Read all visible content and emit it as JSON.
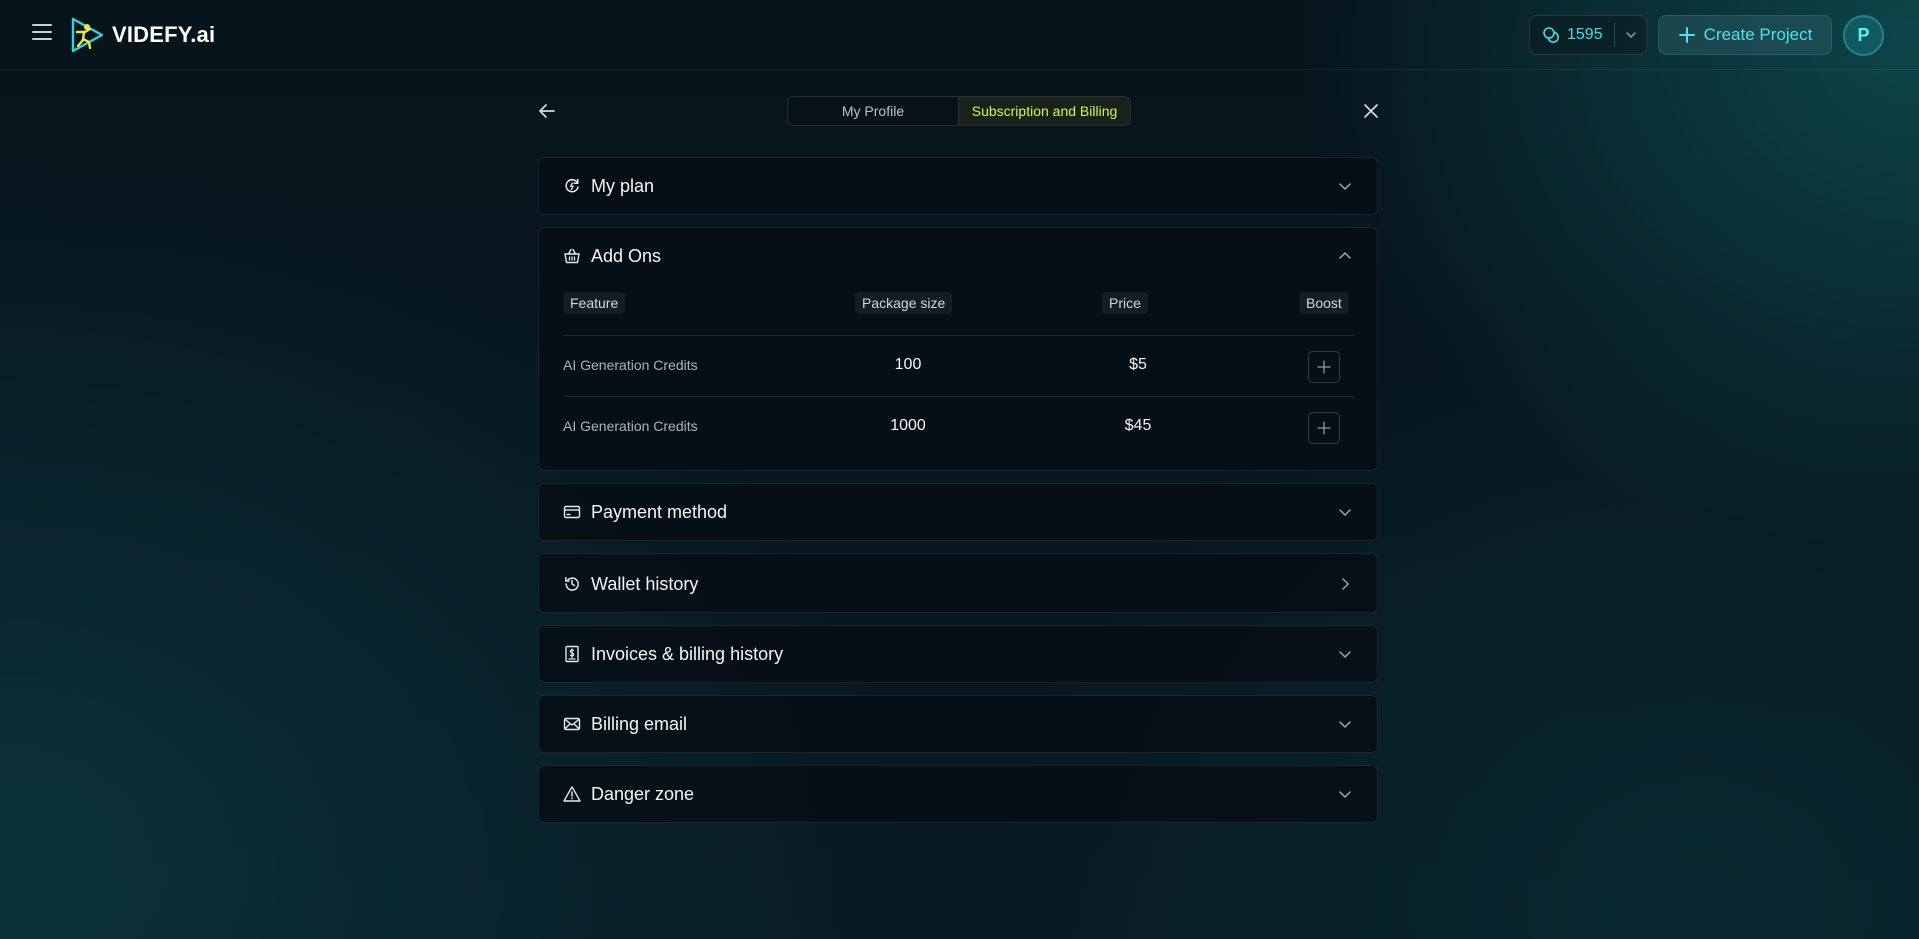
{
  "app": {
    "brand": "VIDEFY.ai",
    "credits": "1595",
    "create_label": "Create Project",
    "avatar_initial": "P",
    "accent": "#3fe0e4"
  },
  "tabs": [
    {
      "label": "My Profile",
      "active": false
    },
    {
      "label": "Subscription and Billing",
      "active": true
    }
  ],
  "sections": {
    "my_plan": "My plan",
    "add_ons": "Add Ons",
    "payment_method": "Payment method",
    "wallet_history": "Wallet history",
    "invoices": "Invoices & billing history",
    "billing_email": "Billing email",
    "danger_zone": "Danger zone"
  },
  "addons": {
    "columns": [
      "Feature",
      "Package size",
      "Price",
      "Boost"
    ],
    "rows": [
      {
        "feature": "AI Generation Credits",
        "size": "100",
        "price": "$5"
      },
      {
        "feature": "AI Generation Credits",
        "size": "1000",
        "price": "$45"
      }
    ]
  }
}
